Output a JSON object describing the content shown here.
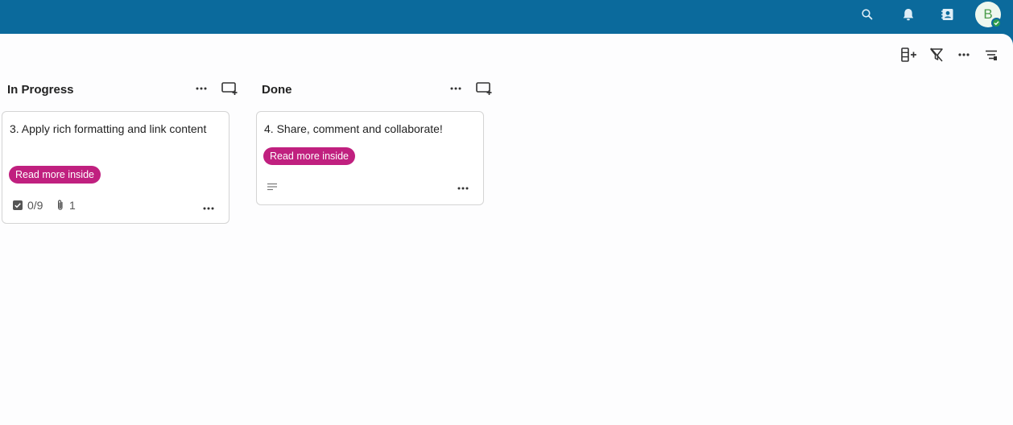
{
  "header": {
    "icons": [
      "search-icon",
      "bell-icon",
      "contacts-icon"
    ],
    "avatar_initial": "B"
  },
  "toolbar": {
    "icons": [
      "add-column-icon",
      "clear-filter-icon",
      "more-icon",
      "view-settings-icon"
    ]
  },
  "columns": [
    {
      "title": "In Progress",
      "cards": [
        {
          "title": "3. Apply rich formatting and link content",
          "tag": "Read more inside",
          "checklist": "0/9",
          "attachments": "1"
        }
      ]
    },
    {
      "title": "Done",
      "cards": [
        {
          "title": "4. Share, comment and collaborate!",
          "tag": "Read more inside"
        }
      ]
    }
  ],
  "colors": {
    "topbar": "#0b6a9c",
    "tag": "#c0207f",
    "presence": "#2e9e4a"
  }
}
